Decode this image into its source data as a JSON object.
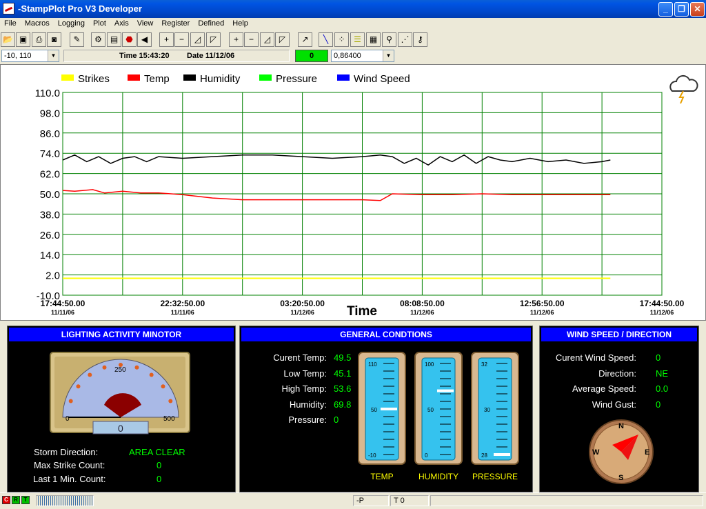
{
  "window": {
    "title": "-StampPlot Pro V3 Developer"
  },
  "menu": [
    "File",
    "Macros",
    "Logging",
    "Plot",
    "Axis",
    "View",
    "Register",
    "Defined",
    "Help"
  ],
  "status": {
    "coord": "-10, 110",
    "time_label": "Time 15:43:20",
    "date_label": "Date 11/12/06",
    "counter": "0",
    "span_value": "0,86400"
  },
  "chart_data": {
    "type": "line",
    "legend": [
      "Strikes",
      "Temp",
      "Humidity",
      "Pressure",
      "Wind Speed"
    ],
    "legend_colors": [
      "#ffff00",
      "#ff0000",
      "#000000",
      "#00ff00",
      "#0000ff"
    ],
    "xlabel": "Time",
    "ylim": [
      -10,
      110
    ],
    "yticks": [
      "110.0",
      "98.0",
      "86.0",
      "74.0",
      "62.0",
      "50.0",
      "38.0",
      "26.0",
      "14.0",
      "2.0",
      "-10.0"
    ],
    "xticks": [
      {
        "time": "17:44:50.00",
        "date": "11/11/06"
      },
      {
        "time": "22:32:50.00",
        "date": "11/11/06"
      },
      {
        "time": "03:20:50.00",
        "date": "11/12/06"
      },
      {
        "time": "08:08:50.00",
        "date": "11/12/06"
      },
      {
        "time": "12:56:50.00",
        "date": "11/12/06"
      },
      {
        "time": "17:44:50.00",
        "date": "11/12/06"
      }
    ],
    "series": [
      {
        "name": "Strikes",
        "color": "#ffff00",
        "t": [
          0,
          0.914
        ],
        "y": [
          0,
          0
        ]
      },
      {
        "name": "Temp",
        "color": "#ff0000",
        "t": [
          0,
          0.02,
          0.05,
          0.07,
          0.1,
          0.13,
          0.16,
          0.2,
          0.25,
          0.3,
          0.35,
          0.4,
          0.45,
          0.5,
          0.53,
          0.55,
          0.6,
          0.65,
          0.7,
          0.75,
          0.8,
          0.85,
          0.9,
          0.914
        ],
        "y": [
          52,
          51.5,
          52.5,
          50.5,
          51.5,
          50.5,
          50.5,
          49.5,
          47.5,
          46.5,
          46.5,
          46.5,
          46.5,
          46.5,
          46,
          50,
          49.5,
          49.5,
          50,
          49.5,
          49.5,
          49.5,
          49.5,
          49.5
        ]
      },
      {
        "name": "Humidity",
        "color": "#000000",
        "t": [
          0,
          0.02,
          0.04,
          0.06,
          0.08,
          0.1,
          0.12,
          0.14,
          0.16,
          0.2,
          0.25,
          0.3,
          0.35,
          0.4,
          0.45,
          0.5,
          0.53,
          0.55,
          0.57,
          0.59,
          0.61,
          0.63,
          0.65,
          0.67,
          0.69,
          0.71,
          0.73,
          0.75,
          0.78,
          0.81,
          0.84,
          0.87,
          0.9,
          0.914
        ],
        "y": [
          70,
          73,
          69,
          72,
          68,
          71,
          72,
          69,
          72,
          71,
          72,
          73,
          73,
          72,
          71,
          72,
          73,
          72,
          68,
          71,
          67,
          72,
          69,
          73,
          68,
          72,
          70,
          69,
          71,
          69,
          70,
          68,
          69,
          70
        ]
      },
      {
        "name": "Pressure",
        "color": "#00ff00",
        "t": [],
        "y": []
      },
      {
        "name": "Wind Speed",
        "color": "#0000ff",
        "t": [],
        "y": []
      }
    ]
  },
  "lighting": {
    "title": "LIGHTING ACTIVITY MINOTOR",
    "gauge_min": "0",
    "gauge_mid": "250",
    "gauge_max": "500",
    "gauge_value": "0",
    "storm_direction_label": "Storm Direction:",
    "storm_direction": "AREA CLEAR",
    "max_strike_label": "Max Strike Count:",
    "max_strike": "0",
    "last_min_label": "Last 1 Min. Count:",
    "last_min": "0"
  },
  "general": {
    "title": "GENERAL CONDTIONS",
    "rows": [
      {
        "label": "Curent Temp:",
        "value": "49.5"
      },
      {
        "label": "Low Temp:",
        "value": "45.1"
      },
      {
        "label": "High Temp:",
        "value": "53.6"
      },
      {
        "label": "Humidity:",
        "value": "69.8"
      },
      {
        "label": "Pressure:",
        "value": "0"
      }
    ],
    "gauges": [
      {
        "name": "TEMP",
        "top": "110",
        "mid": "50",
        "bottom": "-10",
        "level": 0.5
      },
      {
        "name": "HUMIDITY",
        "top": "100",
        "mid": "50",
        "bottom": "0",
        "level": 0.7
      },
      {
        "name": "PRESSURE",
        "top": "32",
        "mid": "30",
        "bottom": "28",
        "level": 0.0
      }
    ]
  },
  "wind": {
    "title": "WIND SPEED / DIRECTION",
    "rows": [
      {
        "label": "Curent Wind Speed:",
        "value": "0"
      },
      {
        "label": "Direction:",
        "value": "NE"
      },
      {
        "label": "Average Speed:",
        "value": "0.0"
      },
      {
        "label": "Wind Gust:",
        "value": "0"
      }
    ],
    "compass": {
      "N": "N",
      "E": "E",
      "S": "S",
      "W": "W"
    }
  },
  "footer": {
    "c": "C",
    "r": "R",
    "t": "T",
    "p": "-P",
    "t0": "T 0"
  }
}
